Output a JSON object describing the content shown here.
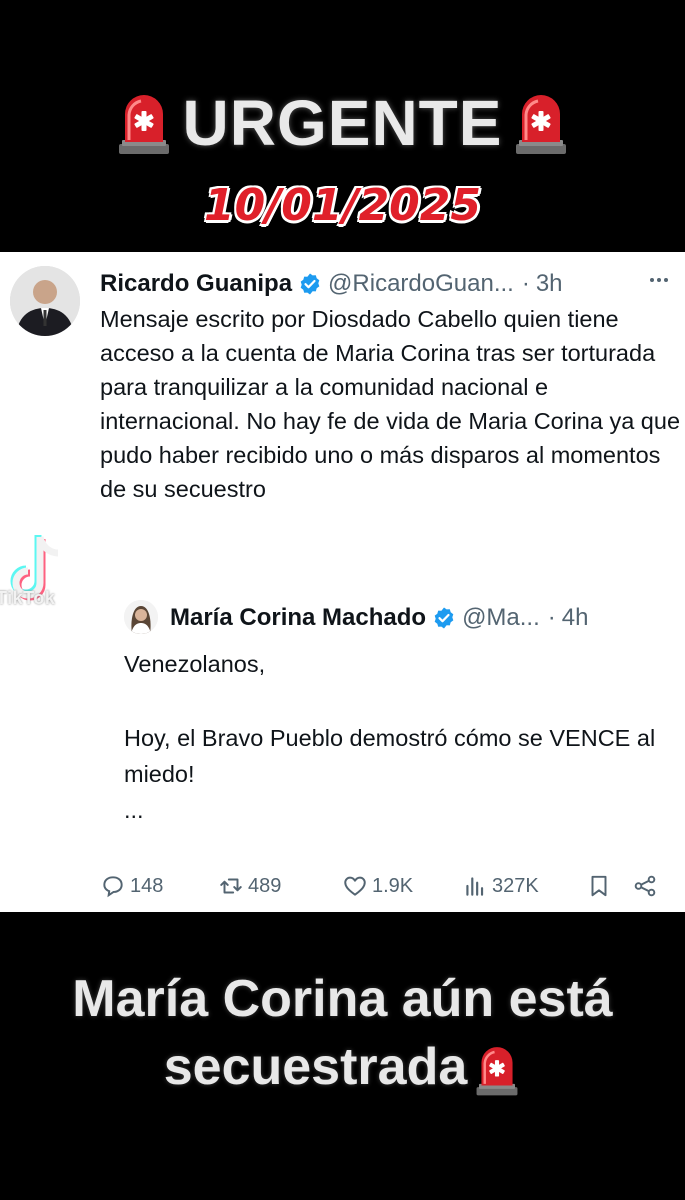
{
  "header": {
    "title": "URGENTE",
    "date": "10/01/2025",
    "icon": "siren-icon"
  },
  "tweet": {
    "author_name": "Ricardo Guanipa",
    "author_handle": "@RicardoGuan...",
    "separator": "·",
    "time": "3h",
    "text": "Mensaje escrito por Diosdado Cabello quien tiene acceso a la cuenta de Maria Corina tras ser torturada para tranquilizar a la comunidad nacional e internacional. No hay fe de vida de Maria Corina ya que pudo haber recibido uno o más disparos al momentos de su secuestro",
    "quote": {
      "author_name": "María Corina Machado",
      "author_handle": "@Ma...",
      "separator": "·",
      "time": "4h",
      "line1": "Venezolanos,",
      "line2": "Hoy, el Bravo Pueblo demostró cómo se VENCE al miedo!",
      "ellipsis": "..."
    },
    "stats": {
      "replies": "148",
      "reposts": "489",
      "likes": "1.9K",
      "views": "327K"
    }
  },
  "watermark": {
    "label": "TikTok"
  },
  "caption": {
    "line1": "María Corina aún está",
    "line2": "secuestrada"
  },
  "colors": {
    "date_red": "#e0202a",
    "verified_blue": "#1d9bf0",
    "muted_gray": "#536471"
  }
}
